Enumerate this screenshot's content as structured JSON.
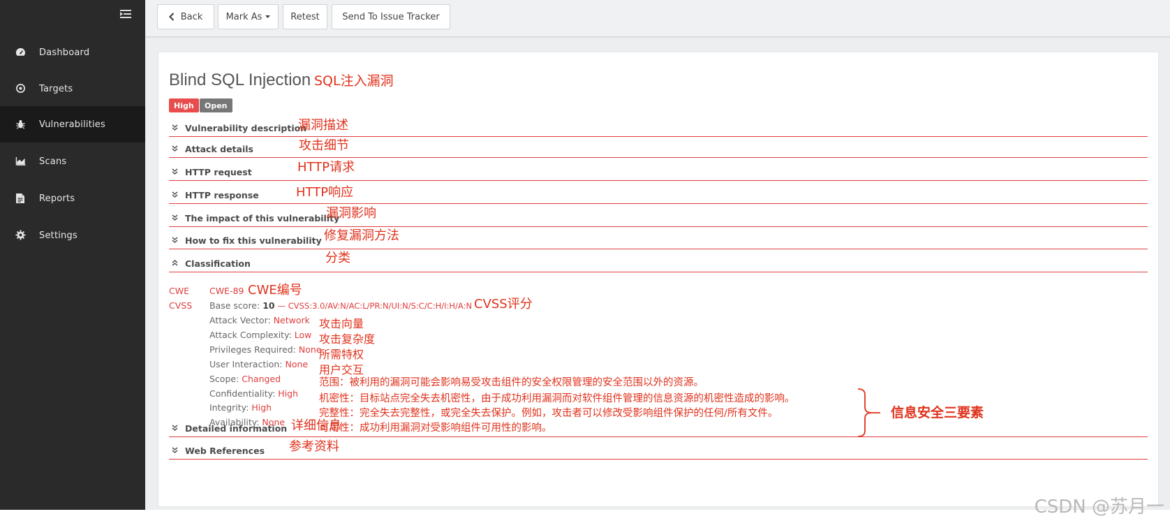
{
  "sidebar": {
    "items": [
      {
        "label": "Dashboard",
        "icon": "dashboard-gauge-icon"
      },
      {
        "label": "Targets",
        "icon": "target-icon"
      },
      {
        "label": "Vulnerabilities",
        "icon": "bug-icon",
        "active": true
      },
      {
        "label": "Scans",
        "icon": "area-chart-icon"
      },
      {
        "label": "Reports",
        "icon": "document-icon"
      },
      {
        "label": "Settings",
        "icon": "gear-icon"
      }
    ]
  },
  "toolbar": {
    "back_label": "Back",
    "mark_as_label": "Mark As",
    "retest_label": "Retest",
    "send_label": "Send To Issue Tracker"
  },
  "vuln": {
    "title": "Blind SQL Injection",
    "severity": "High",
    "status": "Open",
    "severity_color": "#e84c4c",
    "status_color": "#777777"
  },
  "sections": {
    "description": "Vulnerability description",
    "attack_details": "Attack details",
    "http_request": "HTTP request",
    "http_response": "HTTP response",
    "impact": "The impact of this vulnerability",
    "fix": "How to fix this vulnerability",
    "classification": "Classification",
    "detailed": "Detailed information",
    "references": "Web References"
  },
  "classification": {
    "cwe_key": "CWE",
    "cwe_value": "CWE-89",
    "cvss_key": "CVSS",
    "base_score_label": "Base score:",
    "base_score": "10",
    "vector": "— CVSS:3.0/AV:N/AC:L/PR:N/UI:N/S:C/C:H/I:H/A:N",
    "metrics": [
      {
        "label": "Attack Vector:",
        "value": "Network"
      },
      {
        "label": "Attack Complexity:",
        "value": "Low"
      },
      {
        "label": "Privileges Required:",
        "value": "None"
      },
      {
        "label": "User Interaction:",
        "value": "None"
      },
      {
        "label": "Scope:",
        "value": "Changed"
      },
      {
        "label": "Confidentiality:",
        "value": "High"
      },
      {
        "label": "Integrity:",
        "value": "High"
      },
      {
        "label": "Availability:",
        "value": "None"
      }
    ]
  },
  "annotations": {
    "title": "SQL注入漏洞",
    "description": "漏洞描述",
    "attack_details": "攻击细节",
    "http_request": "HTTP请求",
    "http_response": "HTTP响应",
    "impact": "漏洞影响",
    "fix": "修复漏洞方法",
    "classification": "分类",
    "cwe": "CWE编号",
    "cvss": "CVSS评分",
    "attack_vector": "攻击向量",
    "attack_complexity": "攻击复杂度",
    "privileges": "所需特权",
    "user_interaction": "用户交互",
    "scope": "范围：被利用的漏洞可能会影响易受攻击组件的安全权限管理的安全范围以外的资源。",
    "confidentiality": "机密性：目标站点完全失去机密性，由于成功利用漏洞而对软件组件管理的信息资源的机密性造成的影响。",
    "integrity": "完整性：完全失去完整性，或完全失去保护。例如，攻击者可以修改受影响组件保护的任何/所有文件。",
    "availability": "可用性：成功利用漏洞对受影响组件可用性的影响。",
    "cia_triad": "信息安全三要素",
    "detailed": "详细信息",
    "references": "参考资料"
  },
  "watermark": "CSDN @苏月一"
}
